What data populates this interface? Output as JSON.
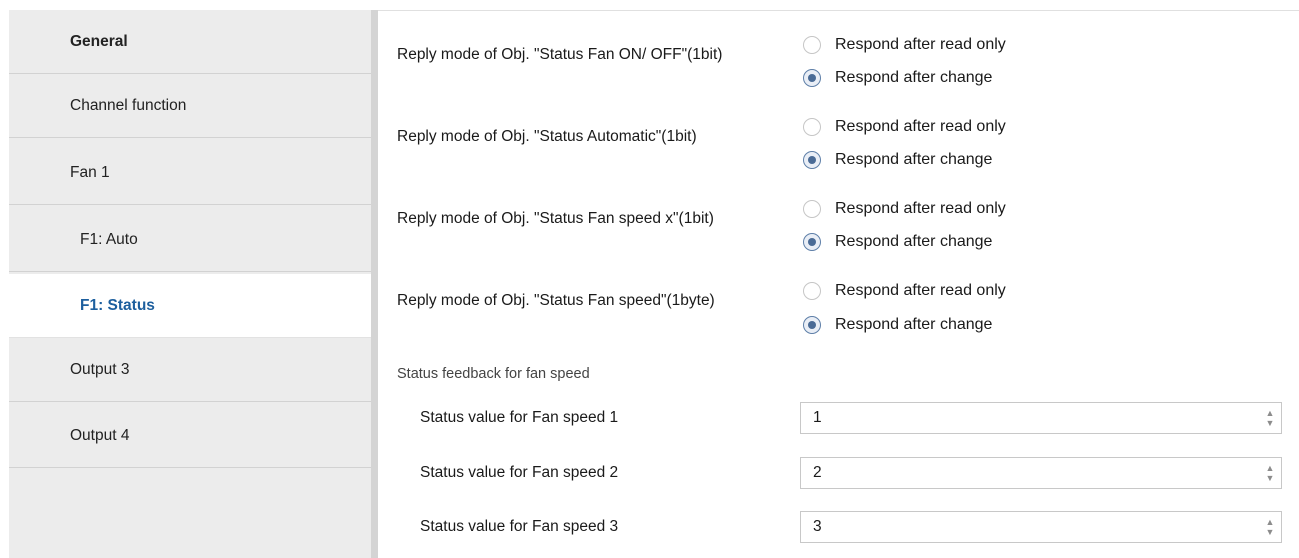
{
  "sidebar": {
    "items": [
      {
        "label": "General"
      },
      {
        "label": "Channel function"
      },
      {
        "label": "Fan 1"
      },
      {
        "label": "F1: Auto"
      },
      {
        "label": "F1: Status"
      },
      {
        "label": "Output 3"
      },
      {
        "label": "Output 4"
      }
    ],
    "active_item": "F1: Status"
  },
  "params": [
    {
      "label": "Reply mode of Obj. \"Status Fan ON/ OFF\"(1bit)",
      "options": [
        "Respond after read only",
        "Respond after change"
      ],
      "selected": "Respond after change"
    },
    {
      "label": "Reply mode of Obj. \"Status Automatic\"(1bit)",
      "options": [
        "Respond after read only",
        "Respond after change"
      ],
      "selected": "Respond after change"
    },
    {
      "label": "Reply mode of Obj. \"Status Fan speed x\"(1bit)",
      "options": [
        "Respond after read only",
        "Respond after change"
      ],
      "selected": "Respond after change"
    },
    {
      "label": "Reply mode of Obj. \"Status Fan speed\"(1byte)",
      "options": [
        "Respond after read only",
        "Respond after change"
      ],
      "selected": "Respond after change"
    }
  ],
  "status_feedback": {
    "section_label": "Status feedback for fan speed",
    "fields": [
      {
        "label": "Status value for Fan speed 1",
        "value": "1"
      },
      {
        "label": "Status value for Fan speed 2",
        "value": "2"
      },
      {
        "label": "Status value for Fan speed 3",
        "value": "3"
      }
    ]
  },
  "icons": {
    "spin_up": "arrow-up-icon",
    "spin_down": "arrow-down-icon",
    "radio": "radio-button"
  },
  "colors": {
    "sidebar_bg": "#ececec",
    "active_text": "#1d5f9e",
    "radio_checked": "#4a6b96"
  }
}
